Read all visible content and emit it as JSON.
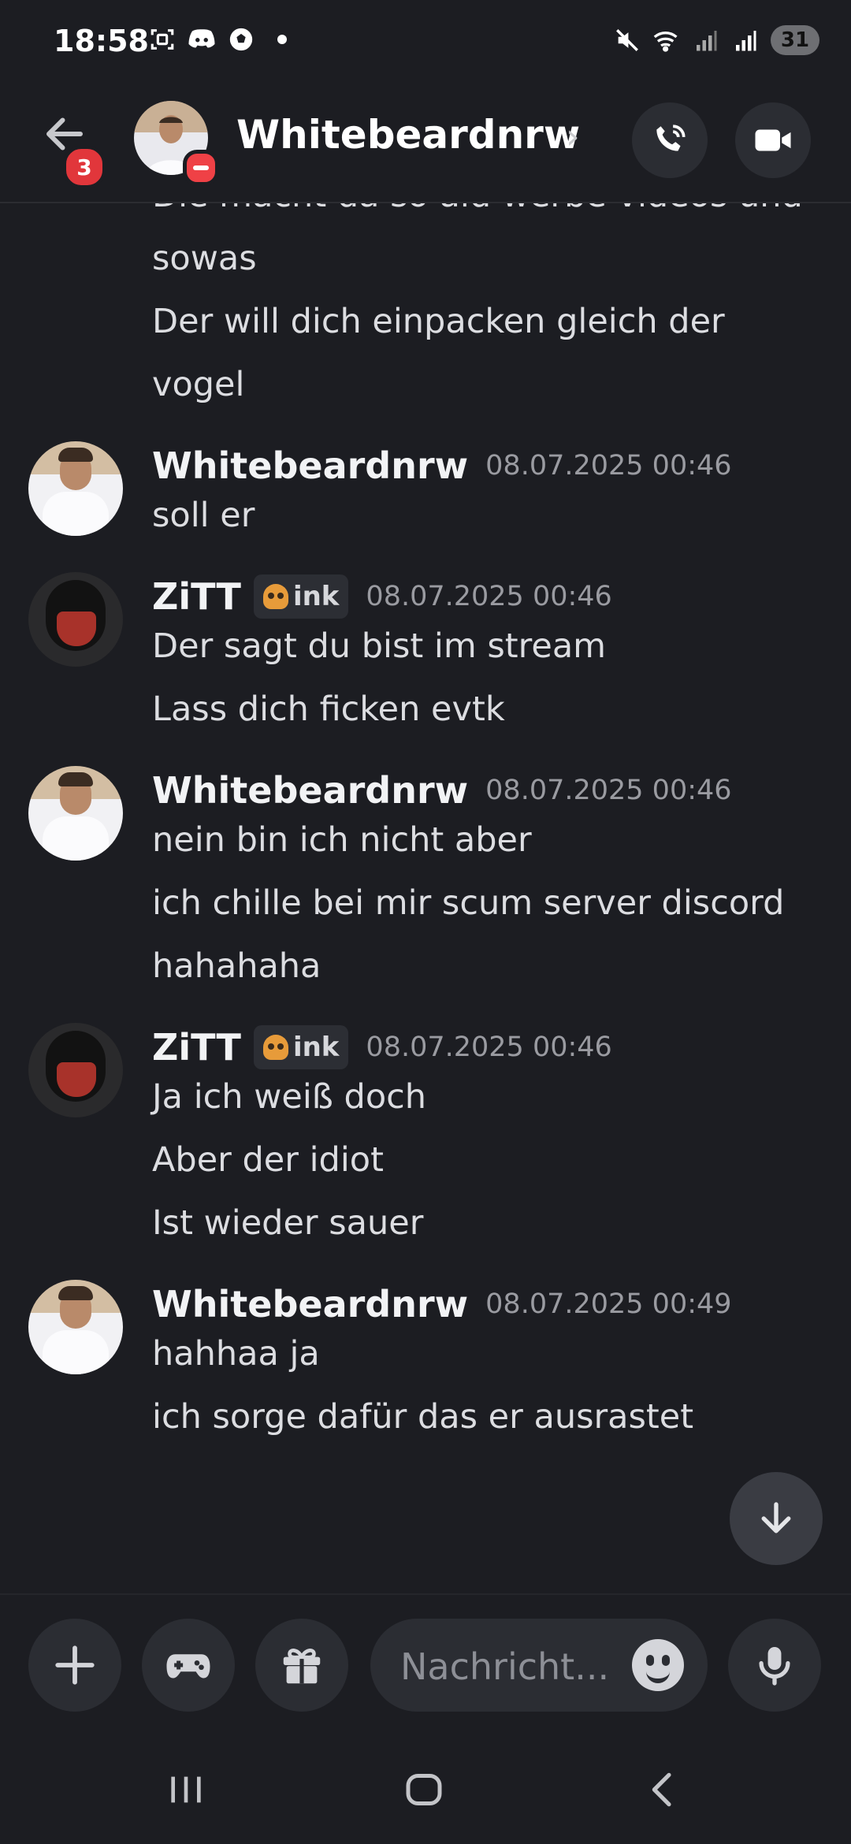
{
  "status_bar": {
    "time": "18:58",
    "left_icons": [
      "screenshot-icon",
      "discord-icon",
      "soccer-icon"
    ],
    "right_icons": [
      "mute-icon",
      "wifi-icon",
      "signal-icon",
      "signal-icon"
    ],
    "battery": "31"
  },
  "header": {
    "back_badge": "3",
    "title": "Whitebeardnrw",
    "actions": [
      "voice-call-icon",
      "video-call-icon"
    ]
  },
  "messages": {
    "partial_lines": [
      "Die macht da so ald werbe videos und",
      "sowas",
      "Der will dich einpacken gleich der",
      "vogel"
    ],
    "groups": [
      {
        "author": "Whitebeardnrw",
        "tag": "",
        "timestamp": "08.07.2025 00:46",
        "lines": [
          "soll er"
        ]
      },
      {
        "author": "ZiTT",
        "tag": "ink",
        "timestamp": "08.07.2025 00:46",
        "lines": [
          "Der sagt du bist im stream",
          "Lass dich ficken evtk"
        ]
      },
      {
        "author": "Whitebeardnrw",
        "tag": "",
        "timestamp": "08.07.2025 00:46",
        "lines": [
          "nein bin ich nicht aber",
          "ich chille bei mir scum server discord",
          "hahahaha"
        ]
      },
      {
        "author": "ZiTT",
        "tag": "ink",
        "timestamp": "08.07.2025 00:46",
        "lines": [
          "Ja ich weiß doch",
          "Aber der idiot",
          "Ist wieder sauer"
        ]
      },
      {
        "author": "Whitebeardnrw",
        "tag": "",
        "timestamp": "08.07.2025 00:49",
        "lines": [
          "hahhaa ja",
          "ich sorge dafür das er ausrastet"
        ]
      }
    ]
  },
  "composer": {
    "placeholder": "Nachricht..."
  },
  "colors": {
    "background": "#1c1d22",
    "surface": "#2b2d33",
    "badge_red": "#e1363b",
    "timestamp": "#9a9ba1"
  }
}
